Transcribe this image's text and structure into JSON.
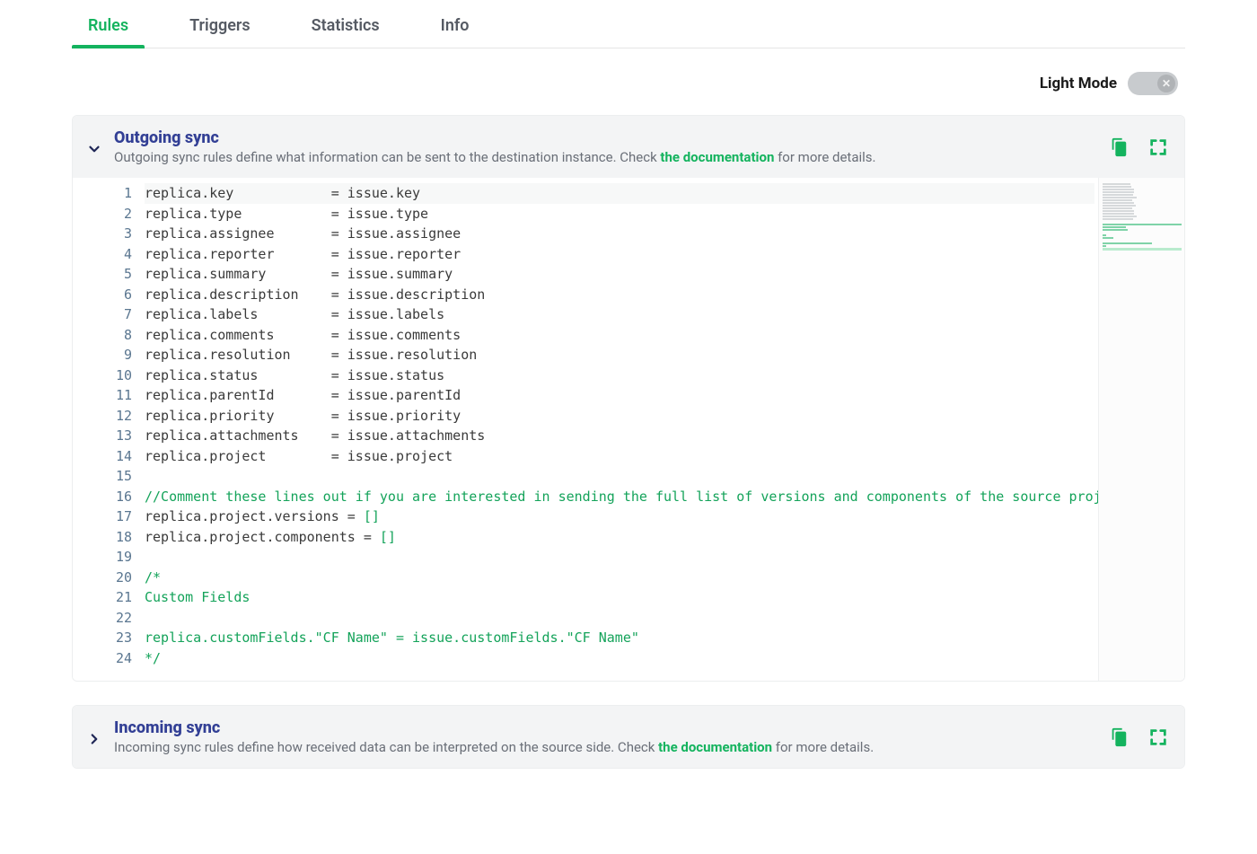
{
  "tabs": [
    {
      "label": "Rules",
      "active": true
    },
    {
      "label": "Triggers",
      "active": false
    },
    {
      "label": "Statistics",
      "active": false
    },
    {
      "label": "Info",
      "active": false
    }
  ],
  "lightMode": {
    "label": "Light Mode",
    "on": false
  },
  "panels": {
    "outgoing": {
      "title": "Outgoing sync",
      "expanded": true,
      "description_pre": "Outgoing sync rules define what information can be sent to the destination instance. Check ",
      "doc_link_text": "the documentation",
      "description_post": " for more details.",
      "code_lines": [
        {
          "n": 1,
          "segments": [
            {
              "t": "replica.key            "
            },
            {
              "t": "= "
            },
            {
              "t": "issue.key"
            }
          ],
          "hl": true
        },
        {
          "n": 2,
          "segments": [
            {
              "t": "replica.type           "
            },
            {
              "t": "= "
            },
            {
              "t": "issue.type"
            }
          ]
        },
        {
          "n": 3,
          "segments": [
            {
              "t": "replica.assignee       "
            },
            {
              "t": "= "
            },
            {
              "t": "issue.assignee"
            }
          ]
        },
        {
          "n": 4,
          "segments": [
            {
              "t": "replica.reporter       "
            },
            {
              "t": "= "
            },
            {
              "t": "issue.reporter"
            }
          ]
        },
        {
          "n": 5,
          "segments": [
            {
              "t": "replica.summary        "
            },
            {
              "t": "= "
            },
            {
              "t": "issue.summary"
            }
          ]
        },
        {
          "n": 6,
          "segments": [
            {
              "t": "replica.description    "
            },
            {
              "t": "= "
            },
            {
              "t": "issue.description"
            }
          ]
        },
        {
          "n": 7,
          "segments": [
            {
              "t": "replica.labels         "
            },
            {
              "t": "= "
            },
            {
              "t": "issue.labels"
            }
          ]
        },
        {
          "n": 8,
          "segments": [
            {
              "t": "replica.comments       "
            },
            {
              "t": "= "
            },
            {
              "t": "issue.comments"
            }
          ]
        },
        {
          "n": 9,
          "segments": [
            {
              "t": "replica.resolution     "
            },
            {
              "t": "= "
            },
            {
              "t": "issue.resolution"
            }
          ]
        },
        {
          "n": 10,
          "segments": [
            {
              "t": "replica.status         "
            },
            {
              "t": "= "
            },
            {
              "t": "issue.status"
            }
          ]
        },
        {
          "n": 11,
          "segments": [
            {
              "t": "replica.parentId       "
            },
            {
              "t": "= "
            },
            {
              "t": "issue.parentId"
            }
          ]
        },
        {
          "n": 12,
          "segments": [
            {
              "t": "replica.priority       "
            },
            {
              "t": "= "
            },
            {
              "t": "issue.priority"
            }
          ]
        },
        {
          "n": 13,
          "segments": [
            {
              "t": "replica.attachments    "
            },
            {
              "t": "= "
            },
            {
              "t": "issue.attachments"
            }
          ]
        },
        {
          "n": 14,
          "segments": [
            {
              "t": "replica.project        "
            },
            {
              "t": "= "
            },
            {
              "t": "issue.project"
            }
          ]
        },
        {
          "n": 15,
          "segments": []
        },
        {
          "n": 16,
          "segments": [
            {
              "cls": "comment",
              "t": "//Comment these lines out if you are interested in sending the full list of versions and components of the source proje"
            }
          ]
        },
        {
          "n": 17,
          "segments": [
            {
              "t": "replica.project.versions "
            },
            {
              "t": "= "
            },
            {
              "cls": "brackets",
              "t": "[]"
            }
          ]
        },
        {
          "n": 18,
          "segments": [
            {
              "t": "replica.project.components "
            },
            {
              "t": "= "
            },
            {
              "cls": "brackets",
              "t": "[]"
            }
          ]
        },
        {
          "n": 19,
          "segments": []
        },
        {
          "n": 20,
          "segments": [
            {
              "cls": "comment",
              "t": "/*"
            }
          ]
        },
        {
          "n": 21,
          "segments": [
            {
              "cls": "comment",
              "t": "Custom Fields"
            }
          ]
        },
        {
          "n": 22,
          "segments": []
        },
        {
          "n": 23,
          "segments": [
            {
              "cls": "comment",
              "t": "replica.customFields.\"CF Name\" = issue.customFields.\"CF Name\""
            }
          ]
        },
        {
          "n": 24,
          "segments": [
            {
              "cls": "comment",
              "t": "*/"
            }
          ]
        }
      ]
    },
    "incoming": {
      "title": "Incoming sync",
      "expanded": false,
      "description_pre": "Incoming sync rules define how received data can be interpreted on the source side. Check ",
      "doc_link_text": "the documentation",
      "description_post": " for more details."
    }
  }
}
